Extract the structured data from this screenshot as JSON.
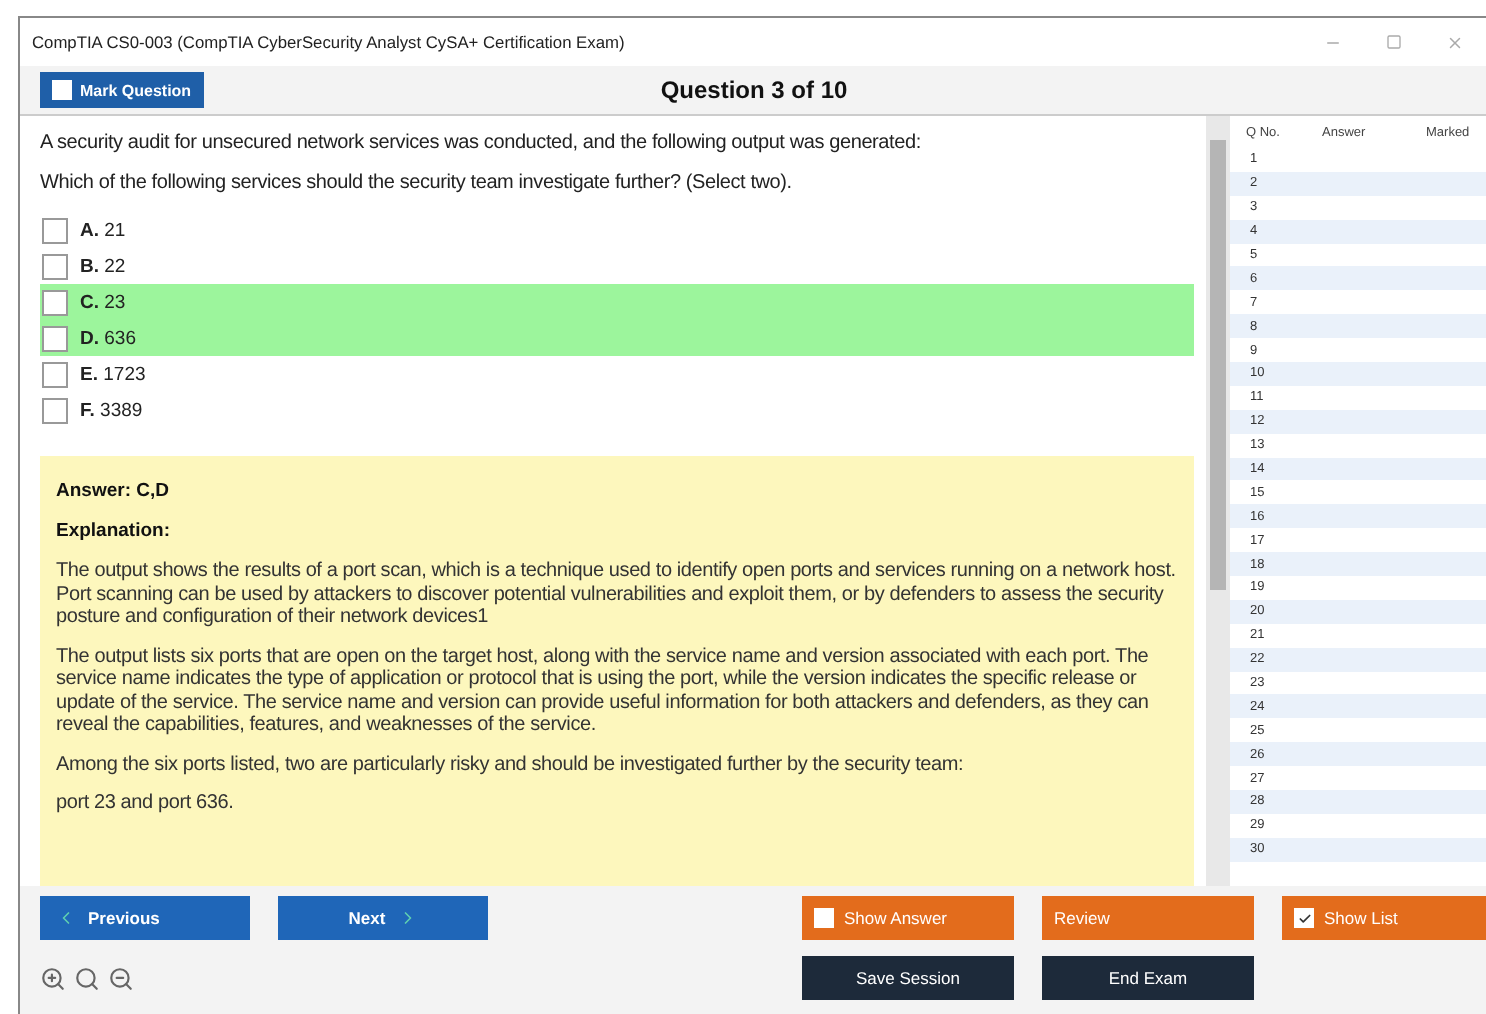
{
  "window": {
    "title": "CompTIA CS0-003 (CompTIA CyberSecurity Analyst CySA+ Certification Exam)"
  },
  "mark_question": {
    "label": "Mark Question",
    "checked": false
  },
  "heading": "Question 3 of 10",
  "question": [
    "A security audit for unsecured network services was conducted, and the following output was generated:",
    "Which of the following services should the security team investigate further? (Select two)."
  ],
  "options": [
    {
      "letter": "A.",
      "text": "21",
      "checked": false,
      "correct": false
    },
    {
      "letter": "B.",
      "text": "22",
      "checked": false,
      "correct": false
    },
    {
      "letter": "C.",
      "text": "23",
      "checked": false,
      "correct": true
    },
    {
      "letter": "D.",
      "text": "636",
      "checked": false,
      "correct": true
    },
    {
      "letter": "E.",
      "text": "1723",
      "checked": false,
      "correct": false
    },
    {
      "letter": "F.",
      "text": "3389",
      "checked": false,
      "correct": false
    }
  ],
  "answer": {
    "title": "Answer: C,D",
    "explanation_label": "Explanation:",
    "paragraphs": [
      "The output shows the results of a port scan, which is a technique used to identify open ports and services running on a network host. Port scanning can be used by attackers to discover potential vulnerabilities and exploit them, or by defenders to assess the security posture and configuration of their network devices1",
      "The output lists six ports that are open on the target host, along with the service name and version associated with each port. The service name indicates the type of application or protocol that is using the port, while the version indicates the specific release or update of the service. The service name and version can provide useful information for both attackers and defenders, as they can reveal the capabilities, features, and weaknesses of the service.",
      "Among the six ports listed, two are particularly risky and should be investigated further by the security team:",
      "port 23 and port 636."
    ]
  },
  "question_list": {
    "columns": [
      "Q No.",
      "Answer",
      "Marked"
    ],
    "rows": [
      "1",
      "2",
      "3",
      "4",
      "5",
      "6",
      "7",
      "8",
      "9",
      "10",
      "11",
      "12",
      "13",
      "14",
      "15",
      "16",
      "17",
      "18",
      "19",
      "20",
      "21",
      "22",
      "23",
      "24",
      "25",
      "26",
      "27",
      "28",
      "29",
      "30"
    ]
  },
  "nav": {
    "previous": "Previous",
    "next": "Next"
  },
  "actions": [
    {
      "kind": "check",
      "label": "Show Answer",
      "checked": false
    },
    {
      "kind": "plain",
      "label": "Review"
    },
    {
      "kind": "check",
      "label": "Show List",
      "checked": true
    }
  ],
  "session": [
    "Save Session",
    "End Exam"
  ]
}
